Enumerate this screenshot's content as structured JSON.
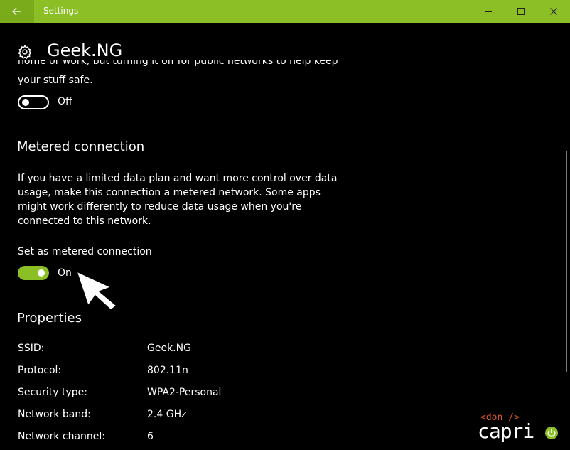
{
  "window": {
    "title": "Settings",
    "accent": "#8cbf26"
  },
  "icons": {
    "back": "back-arrow-icon",
    "minimize": "minimize-icon",
    "maximize": "maximize-icon",
    "close": "close-icon",
    "settings": "gear-icon"
  },
  "header": {
    "title": "Geek.NG"
  },
  "network_profile": {
    "partial_text": "home or work, but turning it off for public networks to help keep",
    "text_tail": "your stuff safe.",
    "toggle_state": "Off"
  },
  "metered": {
    "heading": "Metered connection",
    "description": "If you have a limited data plan and want more control over data usage, make this connection a metered network. Some apps might work differently to reduce data usage when you're connected to this network.",
    "setting_label": "Set as metered connection",
    "toggle_state": "On"
  },
  "properties": {
    "heading": "Properties",
    "rows": [
      {
        "label": "SSID:",
        "value": "Geek.NG"
      },
      {
        "label": "Protocol:",
        "value": "802.11n"
      },
      {
        "label": "Security type:",
        "value": "WPA2-Personal"
      },
      {
        "label": "Network band:",
        "value": "2.4 GHz"
      },
      {
        "label": "Network channel:",
        "value": "6"
      }
    ]
  },
  "watermark": {
    "tag": "<don />",
    "name": "capri"
  }
}
